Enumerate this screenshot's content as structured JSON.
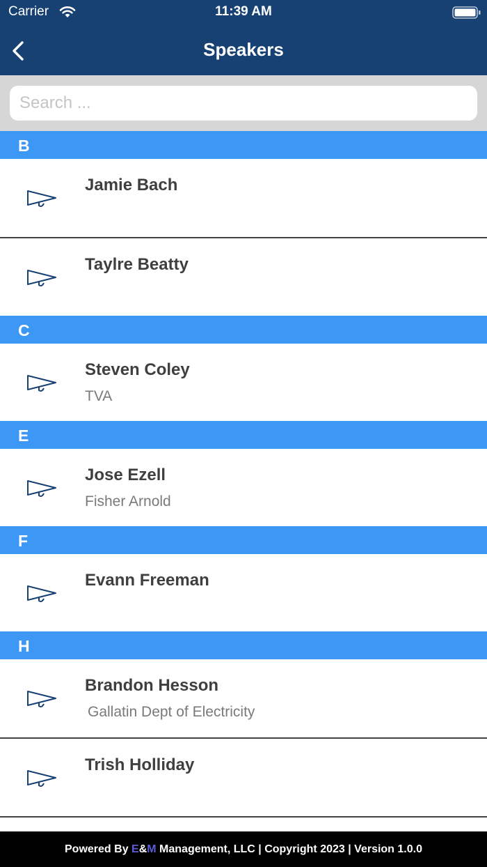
{
  "status_bar": {
    "carrier": "Carrier",
    "time": "11:39 AM"
  },
  "header": {
    "title": "Speakers"
  },
  "search": {
    "placeholder": "Search ..."
  },
  "sections": [
    {
      "letter": "B",
      "speakers": [
        {
          "name": "Jamie Bach",
          "org": ""
        },
        {
          "name": "Taylre Beatty",
          "org": ""
        }
      ]
    },
    {
      "letter": "C",
      "speakers": [
        {
          "name": "Steven Coley",
          "org": "TVA"
        }
      ]
    },
    {
      "letter": "E",
      "speakers": [
        {
          "name": "Jose Ezell",
          "org": "Fisher Arnold"
        }
      ]
    },
    {
      "letter": "F",
      "speakers": [
        {
          "name": "Evann Freeman",
          "org": ""
        }
      ]
    },
    {
      "letter": "H",
      "speakers": [
        {
          "name": "Brandon Hesson",
          "org": "Gallatin Dept of Electricity"
        },
        {
          "name": "Trish Holliday",
          "org": ""
        }
      ]
    }
  ],
  "footer": {
    "prefix": "Powered By ",
    "brand_e": "E",
    "brand_amp": "&",
    "brand_m": "M",
    "suffix": " Management, LLC | Copyright 2023 | Version 1.0.0"
  },
  "colors": {
    "nav": "#174173",
    "section": "#3d98f5",
    "footer": "#000000",
    "icon": "#174173"
  },
  "icons": {
    "row": "megaphone-icon",
    "back": "chevron-left-icon"
  }
}
